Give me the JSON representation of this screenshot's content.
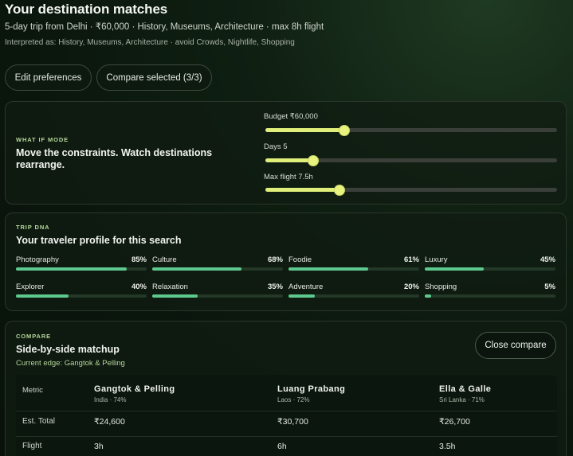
{
  "header": {
    "title": "Your destination matches",
    "subtitle": "5-day trip from Delhi · ₹60,000 · History, Museums, Architecture · max 8h flight",
    "interpreted": "Interpreted as: History, Museums, Architecture · avoid Crowds, Nightlife, Shopping"
  },
  "actions": {
    "edit_label": "Edit preferences",
    "compare_label": "Compare selected (3/3)"
  },
  "what_if": {
    "eyebrow": "WHAT IF MODE",
    "heading": "Move the constraints. Watch destinations rearrange.",
    "sliders": [
      {
        "label": "Budget ₹60,000",
        "fraction": 0.27
      },
      {
        "label": "Days 5",
        "fraction": 0.165
      },
      {
        "label": "Max flight 7.5h",
        "fraction": 0.255
      }
    ]
  },
  "trip_dna": {
    "eyebrow": "TRIP DNA",
    "heading": "Your traveler profile for this search",
    "traits": [
      {
        "name": "Photography",
        "pct": "85%",
        "value": 0.85
      },
      {
        "name": "Culture",
        "pct": "68%",
        "value": 0.68
      },
      {
        "name": "Foodie",
        "pct": "61%",
        "value": 0.61
      },
      {
        "name": "Luxury",
        "pct": "45%",
        "value": 0.45
      },
      {
        "name": "Explorer",
        "pct": "40%",
        "value": 0.4
      },
      {
        "name": "Relaxation",
        "pct": "35%",
        "value": 0.35
      },
      {
        "name": "Adventure",
        "pct": "20%",
        "value": 0.2
      },
      {
        "name": "Shopping",
        "pct": "5%",
        "value": 0.05
      }
    ]
  },
  "compare": {
    "eyebrow": "COMPARE",
    "heading": "Side-by-side matchup",
    "edge": "Current edge: Gangtok & Pelling",
    "close_label": "Close compare",
    "metric_header": "Metric",
    "destinations": [
      {
        "name": "Gangtok & Pelling",
        "sub": "India · 74%"
      },
      {
        "name": "Luang Prabang",
        "sub": "Laos · 72%"
      },
      {
        "name": "Ella & Galle",
        "sub": "Sri Lanka · 71%"
      }
    ],
    "rows": [
      {
        "metric": "Est. Total",
        "values": [
          "₹24,600",
          "₹30,700",
          "₹26,700"
        ]
      },
      {
        "metric": "Flight",
        "values": [
          "3h",
          "6h",
          "3.5h"
        ]
      }
    ]
  }
}
